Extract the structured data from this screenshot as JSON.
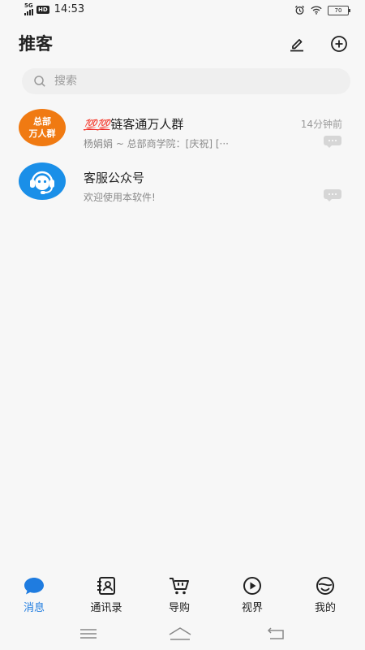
{
  "status_bar": {
    "network": "5G",
    "hd": "HD",
    "time": "14:53",
    "battery": "70"
  },
  "header": {
    "title": "推客",
    "edit_icon": "pencil-icon",
    "add_icon": "plus-circle-icon"
  },
  "search": {
    "placeholder": "搜索",
    "icon": "search-icon"
  },
  "conversations": [
    {
      "avatar_text": [
        "总部",
        "万人群"
      ],
      "name_prefix": "💯💯",
      "name": "链客通万人群",
      "preview": "杨娟娟 ~ 总部商学院：[庆祝] [···",
      "time": "14分钟前",
      "avatar_color": "#f07a12"
    },
    {
      "avatar_icon": "customer-service-headset-icon",
      "name": "客服公众号",
      "preview": "欢迎使用本软件!",
      "time": "",
      "avatar_color": "#1a8fe8"
    }
  ],
  "tabs": [
    {
      "label": "消息",
      "icon": "message-bubble-icon",
      "active": true
    },
    {
      "label": "通讯录",
      "icon": "contacts-book-icon",
      "active": false
    },
    {
      "label": "导购",
      "icon": "shopping-cart-icon",
      "active": false
    },
    {
      "label": "视界",
      "icon": "video-play-icon",
      "active": false
    },
    {
      "label": "我的",
      "icon": "smiley-profile-icon",
      "active": false
    }
  ],
  "system_nav": {
    "menu_icon": "menu-lines-icon",
    "home_icon": "home-icon",
    "back_icon": "back-icon"
  },
  "colors": {
    "accent": "#1f7ce0",
    "background": "#f7f7f7"
  }
}
